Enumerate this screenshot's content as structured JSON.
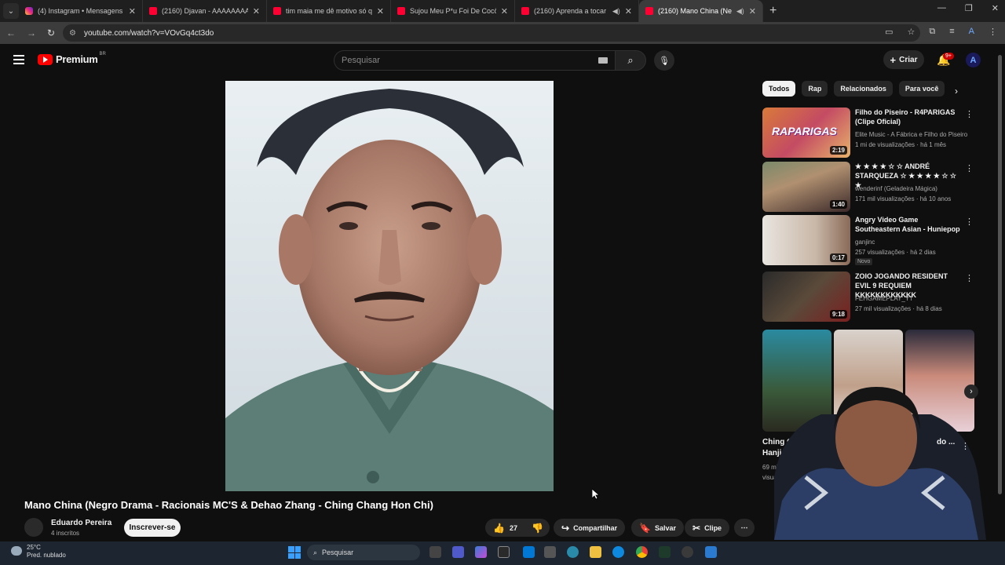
{
  "browser": {
    "tabs": [
      {
        "label": "(4) Instagram • Mensagens",
        "icon": "instagram-icon",
        "active": false
      },
      {
        "label": "(2160) Djavan - AAAAAAAAAAA",
        "icon": "youtube-icon",
        "active": false
      },
      {
        "label": "tim maia me dê motivo só que",
        "icon": "youtube-icon",
        "active": false
      },
      {
        "label": "Sujou Meu P*u Foi De Cocô (VE",
        "icon": "youtube-icon",
        "active": false
      },
      {
        "label": "(2160) Aprenda a tocar PAN",
        "icon": "youtube-icon",
        "active": false
      },
      {
        "label": "(2160) Mano China (Negro",
        "icon": "youtube-icon",
        "active": true
      }
    ],
    "url": "youtube.com/watch?v=VOvGq4ct3do"
  },
  "header": {
    "logo_word": "Premium",
    "logo_region": "BR",
    "search_placeholder": "Pesquisar",
    "create_label": "Criar",
    "notif_count": "9+",
    "avatar_letter": "A"
  },
  "video": {
    "title": "Mano China (Negro Drama - Racionais MC'S & Dehao Zhang - Ching Chang Hon Chi)",
    "channel": "Eduardo Pereira",
    "subscribers": "4 inscritos",
    "subscribe_label": "Inscrever-se",
    "likes": "27",
    "share_label": "Compartilhar",
    "save_label": "Salvar",
    "clip_label": "Clipe"
  },
  "chips": [
    "Todos",
    "Rap",
    "Relacionados",
    "Para você"
  ],
  "recommendations": [
    {
      "title": "Filho do Piseiro - R4PARIGAS (Clipe Oficial)",
      "channel": "Elite Music - A Fábrica e Filho do Piseiro",
      "meta": "1 mi de visualizações · há 1 mês",
      "duration": "2:19",
      "badge": ""
    },
    {
      "title": "★ ★ ★ ★ ☆ ☆ ANDRÉ STARQUEZA ☆ ★ ★ ★ ★ ☆ ☆ ★",
      "channel": "wenderinf (Geladeira Mágica)",
      "meta": "171 mil visualizações · há 10 anos",
      "duration": "1:40",
      "badge": ""
    },
    {
      "title": "Angry Video Game Southeastern Asian - Huniepop",
      "channel": "ganjinc",
      "meta": "257 visualizações · há 2 dias",
      "duration": "0:17",
      "badge": "Novo"
    },
    {
      "title": "ZOIO JOGANDO RESIDENT EVIL 9 REQUIEM KKKKKKKKKKKK",
      "channel": "FEHGAMEPLAY_YT",
      "meta": "27 mil visualizações · há 8 dias",
      "duration": "9:18",
      "badge": ""
    }
  ],
  "shorts": {
    "first_title": "Ching Chen Hanji - ...",
    "first_views": "69 mil visualiza...",
    "third_partial": "do ..."
  },
  "overlay": {
    "brand": "nuvem"
  },
  "taskbar": {
    "temperature": "25°C",
    "weather": "Pred. nublado",
    "search_label": "Pesquisar"
  }
}
